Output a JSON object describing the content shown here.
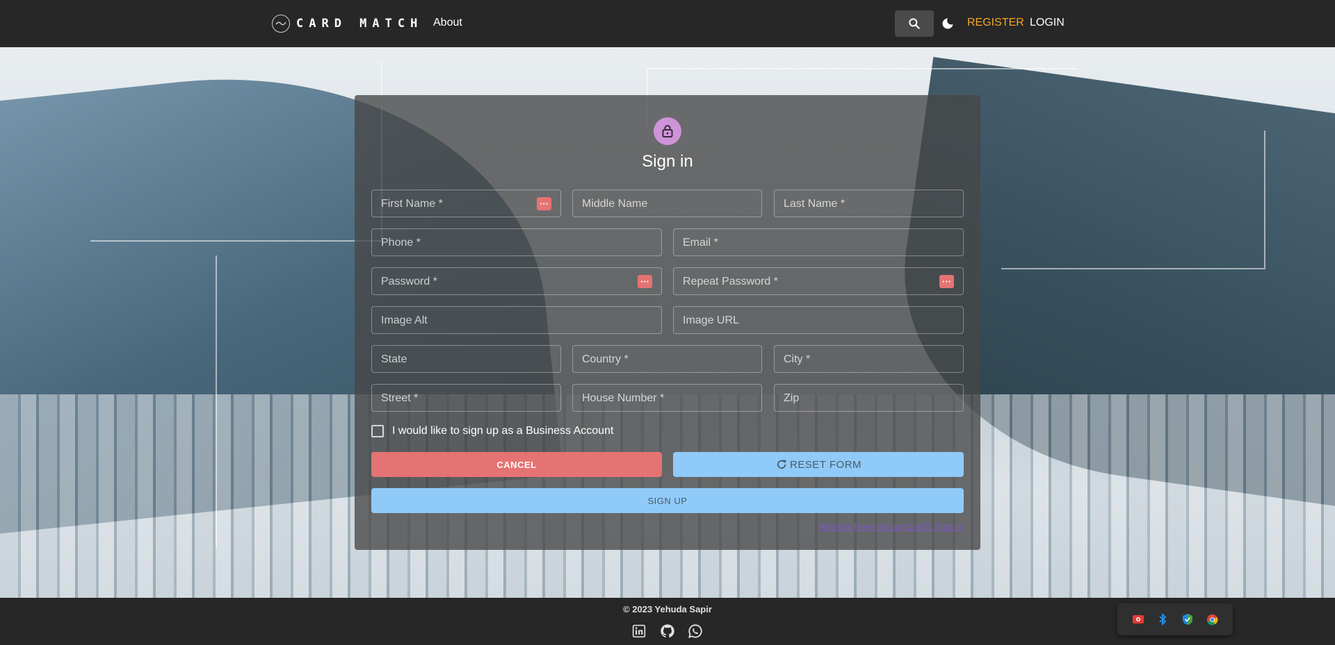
{
  "header": {
    "logo_text": "CARD MATCH",
    "about_label": "About",
    "register_label": "REGISTER",
    "login_label": "LOGIN",
    "search_icon": "search-icon",
    "theme_icon": "moon-icon"
  },
  "form": {
    "title": "Sign in",
    "fields": {
      "first_name": "First Name *",
      "middle_name": "Middle Name",
      "last_name": "Last Name *",
      "phone": "Phone *",
      "email": "Email *",
      "password": "Password *",
      "repeat_password": "Repeat Password *",
      "image_alt": "Image Alt",
      "image_url": "Image URL",
      "state": "State",
      "country": "Country *",
      "city": "City *",
      "street": "Street *",
      "house_number": "House Number *",
      "zip": "Zip"
    },
    "password_manager_glyph": "···",
    "checkbox_label": "I would like to sign up as a Business Account",
    "cancel_label": "CANCEL",
    "reset_label": "RESET FORM",
    "signup_label": "SIGN UP",
    "signin_link": "Already have an account? Sign in"
  },
  "footer": {
    "copyright": "© 2023 Yehuda Sapir",
    "social_icons": [
      "linkedin-icon",
      "github-icon",
      "whatsapp-icon"
    ]
  },
  "tray": {
    "icons": [
      "recorder-icon",
      "bluetooth-icon",
      "security-shield-icon",
      "chrome-icon"
    ]
  },
  "colors": {
    "header_bg": "#272727",
    "register_accent": "#f5a623",
    "lock_avatar": "#ce93d8",
    "cancel_button": "#e57373",
    "primary_button": "#90caf9",
    "link": "#7e57c2"
  }
}
